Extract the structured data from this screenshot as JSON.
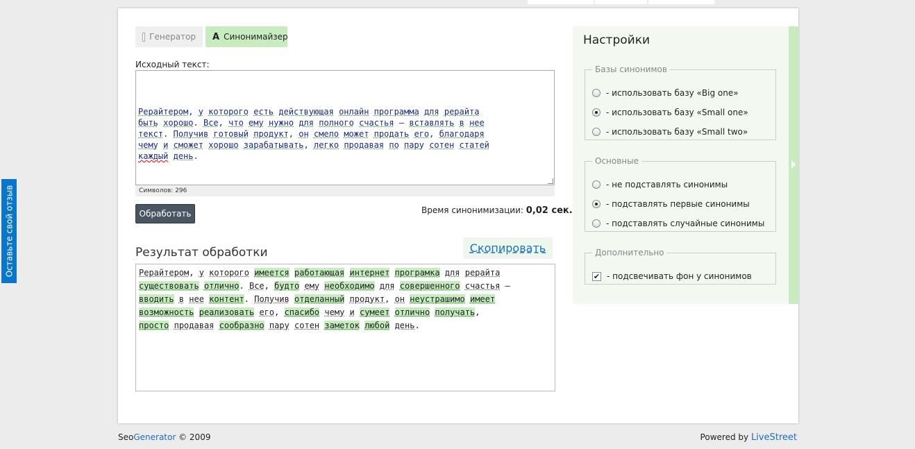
{
  "feedback": {
    "label": "Оставьте свой отзыв"
  },
  "tabs": {
    "generator": "Генератор",
    "synonymizer": "Синонимайзер"
  },
  "source": {
    "label": "Исходный текст:",
    "lines": [
      "Рерайтером, у которого есть действующая онлайн программа для рерайта",
      "быть хорошо. Все, что ему нужно для полного счастья – вставлять в нее",
      "текст. Получив готовый продукт, он смело может продать его, благодаря",
      "чему и сможет хорошо зарабатывать, легко продавая по пару сотен статей",
      "каждый день."
    ],
    "char_count": "Символов: 296"
  },
  "actions": {
    "process": "Обработать",
    "time_label": "Время синонимизации:",
    "time_value": "0,02 сек."
  },
  "result": {
    "title": "Результат обработки",
    "copy": "Скопировать",
    "lines": [
      [
        [
          "Рерайтером",
          0
        ],
        [
          ", ",
          -1
        ],
        [
          "у",
          0
        ],
        [
          " ",
          -1
        ],
        [
          "которого",
          0
        ],
        [
          " ",
          -1
        ],
        [
          "имеется",
          1
        ],
        [
          " ",
          -1
        ],
        [
          "работающая",
          1
        ],
        [
          " ",
          -1
        ],
        [
          "интернет",
          1
        ],
        [
          " ",
          -1
        ],
        [
          "програмка",
          1
        ],
        [
          " ",
          -1
        ],
        [
          "для",
          0
        ],
        [
          " ",
          -1
        ],
        [
          "рерайта",
          0
        ]
      ],
      [
        [
          "существовать",
          1
        ],
        [
          " ",
          -1
        ],
        [
          "отлично",
          1
        ],
        [
          ". ",
          -1
        ],
        [
          "Все",
          0
        ],
        [
          ", ",
          -1
        ],
        [
          "будто",
          1
        ],
        [
          " ",
          -1
        ],
        [
          "ему",
          0
        ],
        [
          " ",
          -1
        ],
        [
          "необходимо",
          1
        ],
        [
          " ",
          -1
        ],
        [
          "для",
          0
        ],
        [
          " ",
          -1
        ],
        [
          "совершенного",
          1
        ],
        [
          " ",
          -1
        ],
        [
          "счастья",
          0
        ],
        [
          " –",
          -1
        ]
      ],
      [
        [
          "вводить",
          1
        ],
        [
          " ",
          -1
        ],
        [
          "в",
          0
        ],
        [
          " ",
          -1
        ],
        [
          "нее",
          0
        ],
        [
          " ",
          -1
        ],
        [
          "контент",
          1
        ],
        [
          ". ",
          -1
        ],
        [
          "Получив",
          0
        ],
        [
          " ",
          -1
        ],
        [
          "отделанный",
          1
        ],
        [
          " ",
          -1
        ],
        [
          "продукт",
          0
        ],
        [
          ", ",
          -1
        ],
        [
          "он",
          0
        ],
        [
          " ",
          -1
        ],
        [
          "неустрашимо",
          1
        ],
        [
          " ",
          -1
        ],
        [
          "имеет",
          1
        ]
      ],
      [
        [
          "возможность",
          1
        ],
        [
          " ",
          -1
        ],
        [
          "реализовать",
          1
        ],
        [
          " ",
          -1
        ],
        [
          "его",
          0
        ],
        [
          ", ",
          -1
        ],
        [
          "спасибо",
          1
        ],
        [
          " ",
          -1
        ],
        [
          "чему",
          0
        ],
        [
          " ",
          -1
        ],
        [
          "и",
          0
        ],
        [
          " ",
          -1
        ],
        [
          "сумеет",
          1
        ],
        [
          " ",
          -1
        ],
        [
          "отлично",
          1
        ],
        [
          " ",
          -1
        ],
        [
          "получать",
          1
        ],
        [
          ",",
          -1
        ]
      ],
      [
        [
          "просто",
          1
        ],
        [
          " ",
          -1
        ],
        [
          "продавая",
          0
        ],
        [
          " ",
          -1
        ],
        [
          "сообразно",
          1
        ],
        [
          " ",
          -1
        ],
        [
          "пару",
          0
        ],
        [
          " ",
          -1
        ],
        [
          "сотен",
          0
        ],
        [
          " ",
          -1
        ],
        [
          "заметок",
          1
        ],
        [
          " ",
          -1
        ],
        [
          "любой",
          1
        ],
        [
          " ",
          -1
        ],
        [
          "день",
          0
        ],
        [
          ".",
          -1
        ]
      ]
    ]
  },
  "settings": {
    "title": "Настройки",
    "bases": {
      "legend": "Базы синонимов",
      "options": [
        {
          "label": "- использовать базу «Big one»",
          "checked": false
        },
        {
          "label": "- использовать базу «Small one»",
          "checked": true
        },
        {
          "label": "- использовать базу «Small two»",
          "checked": false
        }
      ]
    },
    "main": {
      "legend": "Основные",
      "options": [
        {
          "label": "- не подставлять синонимы",
          "checked": false
        },
        {
          "label": "- подставлять первые синонимы",
          "checked": true
        },
        {
          "label": "- подставлять случайные синонимы",
          "checked": false
        }
      ]
    },
    "extra": {
      "legend": "Дополнительно",
      "options": [
        {
          "label": "- подсвечивать фон у синонимов",
          "checked": true
        }
      ]
    }
  },
  "footer": {
    "seo": "Seo",
    "generator": "Generator",
    "copy": "© 2009",
    "powered": "Powered by",
    "livestreet": "LiveStreet"
  }
}
